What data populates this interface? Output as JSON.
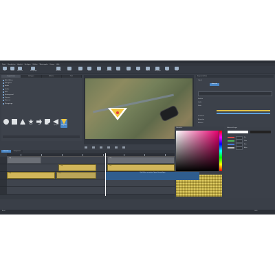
{
  "window": {
    "title": "Sequence Editor"
  },
  "menu": [
    "Datei",
    "Bearbeiten",
    "Ansicht",
    "Einfügen",
    "Effekte",
    "Wiedergabe",
    "Extras",
    "Hilfe"
  ],
  "toolbar": [
    {
      "label": "Neu"
    },
    {
      "label": "Öffnen"
    },
    {
      "label": "Speichern"
    },
    {
      "label": "Rückgängig"
    },
    {
      "label": "Vorschau"
    },
    {
      "label": "Schnitt"
    },
    {
      "label": "Marker"
    },
    {
      "label": "Zoom"
    },
    {
      "label": "Export"
    },
    {
      "label": "Brennen"
    },
    {
      "label": "Upload"
    },
    {
      "label": "Import"
    },
    {
      "label": "Titel"
    },
    {
      "label": "Effekte"
    },
    {
      "label": "Übergänge"
    },
    {
      "label": "Audio"
    },
    {
      "label": "Hilfe"
    }
  ],
  "left_panel": {
    "tabs": [
      "Importieren",
      "Vorlagen",
      "Effekte",
      "Titel"
    ],
    "tree": [
      "Alle Effekte",
      "Kategorie",
      "Audio",
      "Größe",
      "Bild",
      "Hintergrund",
      "Formen",
      "Kamera",
      "Übergänge"
    ],
    "shapes": [
      "Kreis",
      "Rechteck",
      "Dreieck",
      "Stern",
      "Pfeil",
      "Form",
      "Spiegel",
      "Wegpunkt"
    ],
    "selected_shape": "Wegpunkt"
  },
  "preview": {
    "zoom": "100%",
    "controls": [
      "play",
      "stop",
      "prev",
      "next",
      "loop",
      "fullscreen"
    ]
  },
  "right_panel": {
    "header": "Eigenschaften",
    "rows": [
      "Objekt",
      "Position",
      "Größe",
      "Farbe",
      "Deckkraft",
      "Animation",
      "Rahmen"
    ],
    "button_label": "Anwenden"
  },
  "color_picker": {
    "title": "Farbwähler"
  },
  "color_panel": {
    "title": "Farbeinstellungen",
    "rows": [
      "Rot",
      "Grün",
      "Blau",
      "Alpha"
    ]
  },
  "timeline": {
    "tabs": [
      "Timeline",
      "Storyboard"
    ],
    "active_tab": "Timeline",
    "clips": [
      {
        "label": "Clip"
      },
      {
        "label": "Clip"
      },
      {
        "label": "Clip"
      },
      {
        "label": "Clip"
      },
      {
        "label": "Clip"
      },
      {
        "label": "Clip"
      }
    ],
    "hint": "Hier klicken, um weitere Spuren hinzuzufügen"
  },
  "status_bar": {
    "left": "Bereit",
    "right": "100%"
  }
}
